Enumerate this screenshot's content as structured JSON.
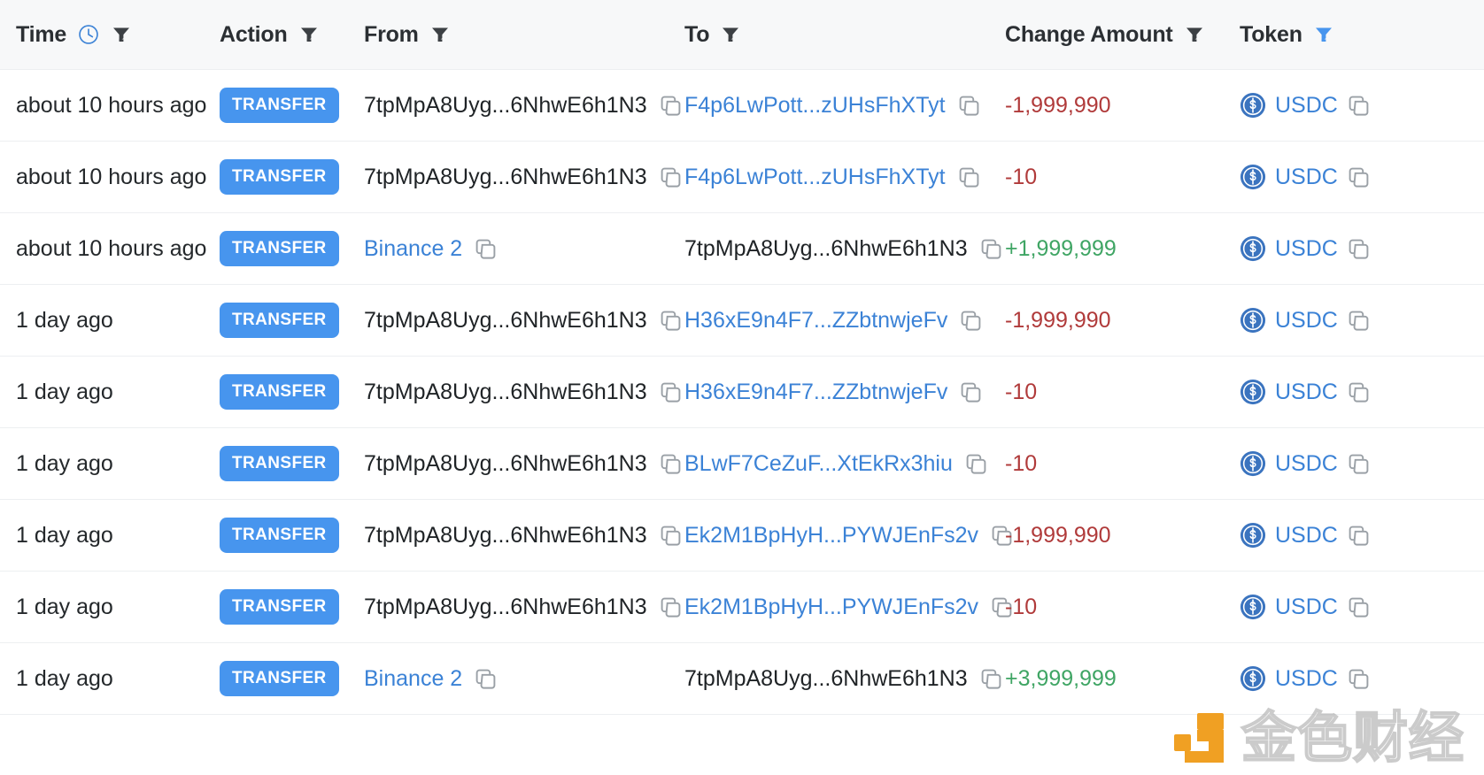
{
  "table": {
    "columns": [
      {
        "key": "time",
        "label": "Time",
        "has_clock_icon": true,
        "filter": true,
        "filter_active": false
      },
      {
        "key": "action",
        "label": "Action",
        "has_clock_icon": false,
        "filter": true,
        "filter_active": false
      },
      {
        "key": "from",
        "label": "From",
        "has_clock_icon": false,
        "filter": true,
        "filter_active": false
      },
      {
        "key": "to",
        "label": "To",
        "has_clock_icon": false,
        "filter": true,
        "filter_active": false
      },
      {
        "key": "amount",
        "label": "Change Amount",
        "has_clock_icon": false,
        "filter": true,
        "filter_active": false
      },
      {
        "key": "token",
        "label": "Token",
        "has_clock_icon": false,
        "filter": true,
        "filter_active": true
      }
    ],
    "rows": [
      {
        "time": "about 10 hours ago",
        "action": "TRANSFER",
        "from": "7tpMpA8Uyg...6NhwE6h1N3",
        "from_is_link": false,
        "to": "F4p6LwPott...zUHsFhXTyt",
        "to_is_link": true,
        "amount": "-1,999,990",
        "amount_sign": "neg",
        "token": "USDC"
      },
      {
        "time": "about 10 hours ago",
        "action": "TRANSFER",
        "from": "7tpMpA8Uyg...6NhwE6h1N3",
        "from_is_link": false,
        "to": "F4p6LwPott...zUHsFhXTyt",
        "to_is_link": true,
        "amount": "-10",
        "amount_sign": "neg",
        "token": "USDC"
      },
      {
        "time": "about 10 hours ago",
        "action": "TRANSFER",
        "from": "Binance 2",
        "from_is_link": true,
        "to": "7tpMpA8Uyg...6NhwE6h1N3",
        "to_is_link": false,
        "amount": "+1,999,999",
        "amount_sign": "pos",
        "token": "USDC"
      },
      {
        "time": "1 day ago",
        "action": "TRANSFER",
        "from": "7tpMpA8Uyg...6NhwE6h1N3",
        "from_is_link": false,
        "to": "H36xE9n4F7...ZZbtnwjeFv",
        "to_is_link": true,
        "amount": "-1,999,990",
        "amount_sign": "neg",
        "token": "USDC"
      },
      {
        "time": "1 day ago",
        "action": "TRANSFER",
        "from": "7tpMpA8Uyg...6NhwE6h1N3",
        "from_is_link": false,
        "to": "H36xE9n4F7...ZZbtnwjeFv",
        "to_is_link": true,
        "amount": "-10",
        "amount_sign": "neg",
        "token": "USDC"
      },
      {
        "time": "1 day ago",
        "action": "TRANSFER",
        "from": "7tpMpA8Uyg...6NhwE6h1N3",
        "from_is_link": false,
        "to": "BLwF7CeZuF...XtEkRx3hiu",
        "to_is_link": true,
        "amount": "-10",
        "amount_sign": "neg",
        "token": "USDC"
      },
      {
        "time": "1 day ago",
        "action": "TRANSFER",
        "from": "7tpMpA8Uyg...6NhwE6h1N3",
        "from_is_link": false,
        "to": "Ek2M1BpHyH...PYWJEnFs2v",
        "to_is_link": true,
        "amount": "-1,999,990",
        "amount_sign": "neg",
        "token": "USDC"
      },
      {
        "time": "1 day ago",
        "action": "TRANSFER",
        "from": "7tpMpA8Uyg...6NhwE6h1N3",
        "from_is_link": false,
        "to": "Ek2M1BpHyH...PYWJEnFs2v",
        "to_is_link": true,
        "amount": "-10",
        "amount_sign": "neg",
        "token": "USDC"
      },
      {
        "time": "1 day ago",
        "action": "TRANSFER",
        "from": "Binance 2",
        "from_is_link": true,
        "to": "7tpMpA8Uyg...6NhwE6h1N3",
        "to_is_link": false,
        "amount": "+3,999,999",
        "amount_sign": "pos",
        "token": "USDC"
      }
    ]
  },
  "watermark": {
    "text": "金色财经"
  },
  "colors": {
    "accent_blue": "#4795ee",
    "link_blue": "#3b82d6",
    "negative_red": "#b03a3a",
    "positive_green": "#3fa564",
    "header_bg": "#f7f8f9",
    "watermark_orange": "#f0a023"
  }
}
